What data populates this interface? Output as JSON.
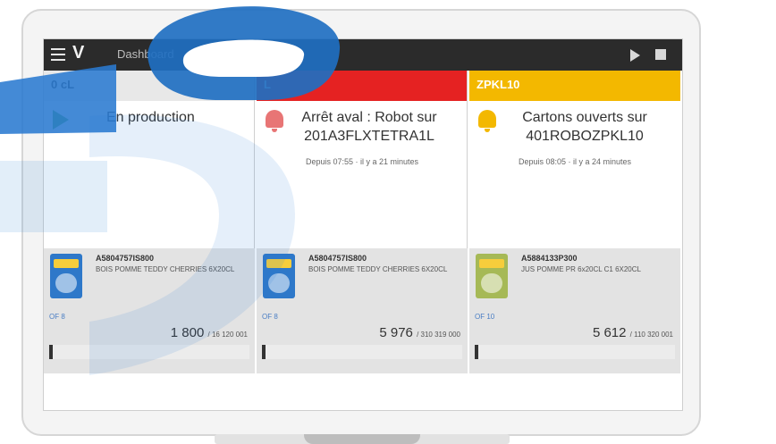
{
  "app": {
    "title": "Dashboard"
  },
  "columns": [
    {
      "header": "0 cL",
      "status_text": "En production",
      "status_sub": "",
      "product_code": "A5804757IS800",
      "product_desc": "BOIS POMME TEDDY CHERRIES 6X20CL",
      "of_label": "OF 8",
      "qty": "1 800",
      "qty_total": "/ 16 120 001",
      "progress": 0.02,
      "accent": "#e8e8e8"
    },
    {
      "header": "L",
      "status_text": "Arrêt aval : Robot sur 201A3FLXTETRA1L",
      "status_sub": "Depuis 07:55 · il y a 21 minutes",
      "product_code": "A5804757IS800",
      "product_desc": "BOIS POMME TEDDY CHERRIES 6X20CL",
      "of_label": "OF 8",
      "qty": "5 976",
      "qty_total": "/ 310 319 000",
      "progress": 0.02,
      "accent": "#e52222"
    },
    {
      "header": "ZPKL10",
      "status_text": "Cartons ouverts sur 401ROBOZPKL10",
      "status_sub": "Depuis 08:05 · il y a 24 minutes",
      "product_code": "A5884133P300",
      "product_desc": "JUS POMME PR 6x20CL C1 6X20CL",
      "of_label": "OF 10",
      "qty": "5 612",
      "qty_total": "/ 110 320 001",
      "progress": 0.02,
      "accent": "#f3b800"
    }
  ],
  "icons": {
    "menu": "menu-icon",
    "logo": "V",
    "play": "play-icon",
    "stop": "stop-icon",
    "status_running": "play-triangle-icon",
    "status_alarm": "bell-icon"
  }
}
